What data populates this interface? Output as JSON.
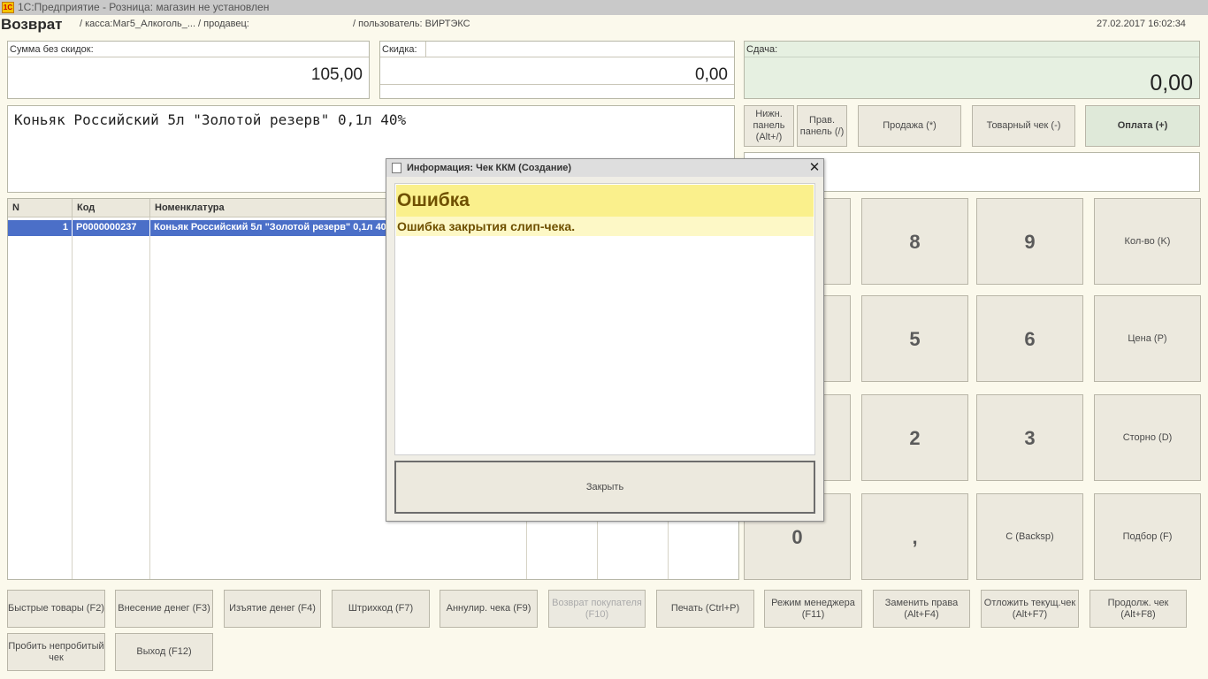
{
  "titlebar": {
    "icon": "1C",
    "title": "1С:Предприятие - Розница: магазин не установлен"
  },
  "header": {
    "mode": "Возврат",
    "kassa": "/ касса:Маг5_Алкоголь_... / продавец:",
    "user": "/ пользователь: ВИРТЭКС",
    "datetime": "27.02.2017 16:02:34"
  },
  "totals": {
    "sum_label": "Сумма без скидок:",
    "sum_value": "105,00",
    "discount_label": "Скидка:",
    "discount_value": "0,00",
    "change_label": "Сдача:",
    "change_value": "0,00"
  },
  "current_item": "Коньяк Российский 5л \"Золотой резерв\" 0,1л 40%",
  "top_buttons": {
    "lower_panel": "Нижн. панель (Alt+/)",
    "right_panel": "Прав. панель (/)",
    "sale": "Продажа (*)",
    "goods_receipt": "Товарный чек (-)",
    "payment": "Оплата (+)"
  },
  "table": {
    "columns": [
      "N",
      "Код",
      "Номенклатура"
    ],
    "rows": [
      {
        "n": "1",
        "code": "P0000000237",
        "name": "Коньяк Российский 5л \"Золотой резерв\" 0,1л 40%"
      }
    ]
  },
  "keypad": {
    "k8": "8",
    "k9": "9",
    "qty": "Кол-во (K)",
    "k5": "5",
    "k6": "6",
    "price": "Цена (P)",
    "k2": "2",
    "k3": "3",
    "storno": "Сторно (D)",
    "k0": "0",
    "comma": ",",
    "backspace": "C (Backsp)",
    "selection": "Подбор (F)"
  },
  "bottom_buttons": {
    "quick_goods": "Быстрые товары (F2)",
    "cash_in": "Внесение денег (F3)",
    "cash_out": "Изъятие денег (F4)",
    "barcode": "Штрихкод (F7)",
    "cancel_receipt": "Аннулир. чека (F9)",
    "customer_return": "Возврат покупателя (F10)",
    "print": "Печать (Ctrl+P)",
    "manager_mode": "Режим менеджера (F11)",
    "change_rights": "Заменить права (Alt+F4)",
    "postpone_receipt": "Отложить текущ.чек (Alt+F7)",
    "continue_receipt": "Продолж. чек (Alt+F8)",
    "print_unprinted": "Пробить непробитый чек",
    "exit": "Выход (F12)"
  },
  "dialog": {
    "title": "Информация: Чек ККМ (Создание)",
    "close_glyph": "✕",
    "heading": "Ошибка",
    "message": "Ошибка закрытия слип-чека.",
    "button": "Закрыть"
  }
}
